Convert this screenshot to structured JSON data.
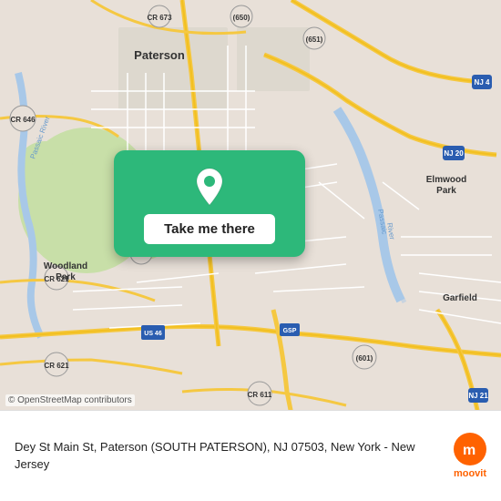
{
  "map": {
    "credit": "© OpenStreetMap contributors",
    "area": "Paterson, NJ area"
  },
  "overlay": {
    "button_label": "Take me there"
  },
  "info": {
    "address": "Dey St Main St, Paterson (SOUTH PATERSON), NJ 07503, New York - New Jersey"
  },
  "logo": {
    "name": "moovit",
    "label": "moovit"
  },
  "roads": {
    "cr673": "CR 673",
    "cr646": "CR 646",
    "cr621_1": "CR 621",
    "cr621_2": "CR 621",
    "cr611": "CR 611",
    "cr601": "(601)",
    "nj4": "NJ 4",
    "nj20": "NJ 20",
    "nj21": "NJ 21",
    "nj_main": "NJ",
    "us46": "US 46",
    "gsp": "GSP",
    "num650": "(650)",
    "num651": "(651)",
    "paterson_label": "Paterson",
    "elmwood_label": "Elmwood\nPark",
    "woodland_label": "Woodland\nPark",
    "garfield_label": "Garfield"
  }
}
